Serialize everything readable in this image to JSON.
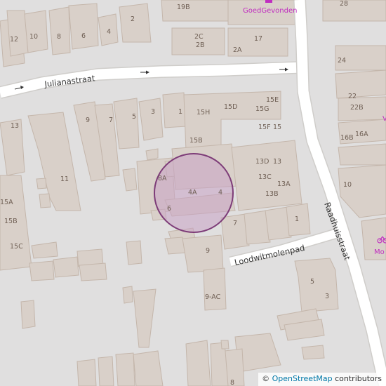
{
  "map": {
    "streets": {
      "julianastraat": "Julianastraat",
      "raadhuisstraat": "Raadhuisstraat",
      "loodwitmolenpad": "Loodwitmolenpad"
    },
    "poi": {
      "shop_name": "GoedGevonden",
      "shop_icon": "shop-icon",
      "shop_color": "#c02ec0"
    },
    "selection_marker": {
      "color": "#7d3c78",
      "fill": "#c9a3c5"
    },
    "house_numbers": {
      "n19b": "19B",
      "n28": "28",
      "n2c": "2C",
      "n2b": "2B",
      "n2a": "2A",
      "n17": "17",
      "n24": "24",
      "n12": "12",
      "n10": "10",
      "n8": "8",
      "n6": "6",
      "n4": "4",
      "n2": "2",
      "n22": "22",
      "n22b": "22B",
      "n16a": "16A",
      "n16b": "16B",
      "n13": "13",
      "n9": "9",
      "n7": "7",
      "n5": "5",
      "n3": "3",
      "n1": "1",
      "n15h": "15H",
      "n15d": "15D",
      "n15e": "15E",
      "n15g": "15G",
      "n15f": "15F",
      "n15": "15",
      "n15b": "15B",
      "n11": "11",
      "n13d": "13D",
      "n13b2": "13",
      "n13c": "13C",
      "n13a": "13A",
      "n13b": "13B",
      "n8a": "8A",
      "n4a": "4A",
      "n4b": "4",
      "n6b": "6",
      "n7b": "7",
      "n1b": "1",
      "n9b": "9",
      "n10b": "10",
      "n15a": "15A",
      "n15b2": "15B",
      "n15c": "15C",
      "n5b": "5",
      "n3b": "3",
      "n9ac": "9-AC",
      "n8b": "8"
    }
  },
  "attribution": {
    "prefix": "© ",
    "link_text": "OpenStreetMap",
    "suffix": " contributors"
  }
}
